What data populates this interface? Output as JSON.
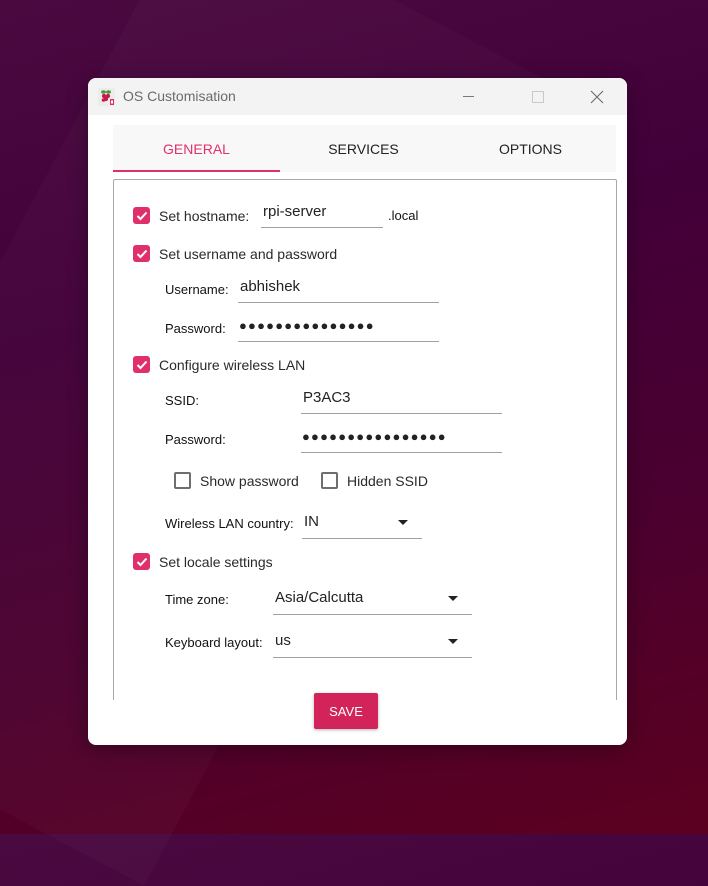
{
  "window": {
    "title": "OS Customisation",
    "icon": "raspberry-pi-icon",
    "controls": [
      "minimize-icon",
      "maximize-icon",
      "close-icon"
    ]
  },
  "tabs": [
    {
      "label": "GENERAL",
      "active": true
    },
    {
      "label": "SERVICES",
      "active": false
    },
    {
      "label": "OPTIONS",
      "active": false
    }
  ],
  "general": {
    "hostname": {
      "label": "Set hostname:",
      "checked": true,
      "value": "rpi-server",
      "suffix": ".local"
    },
    "user": {
      "label": "Set username and password",
      "checked": true,
      "username_label": "Username:",
      "username": "abhishek",
      "password_label": "Password:",
      "password_masked": "●●●●●●●●●●●●●●●"
    },
    "wlan": {
      "label": "Configure wireless LAN",
      "checked": true,
      "ssid_label": "SSID:",
      "ssid": "P3AC3",
      "password_label": "Password:",
      "password_masked": "●●●●●●●●●●●●●●●●",
      "show_password": {
        "label": "Show password",
        "checked": false
      },
      "hidden_ssid": {
        "label": "Hidden SSID",
        "checked": false
      },
      "country_label": "Wireless LAN country:",
      "country": "IN"
    },
    "locale": {
      "label": "Set locale settings",
      "checked": true,
      "timezone_label": "Time zone:",
      "timezone": "Asia/Calcutta",
      "keyboard_label": "Keyboard layout:",
      "keyboard": "us"
    }
  },
  "actions": {
    "save_label": "SAVE"
  },
  "colors": {
    "accent": "#e0306b",
    "save_button": "#d2245a"
  }
}
